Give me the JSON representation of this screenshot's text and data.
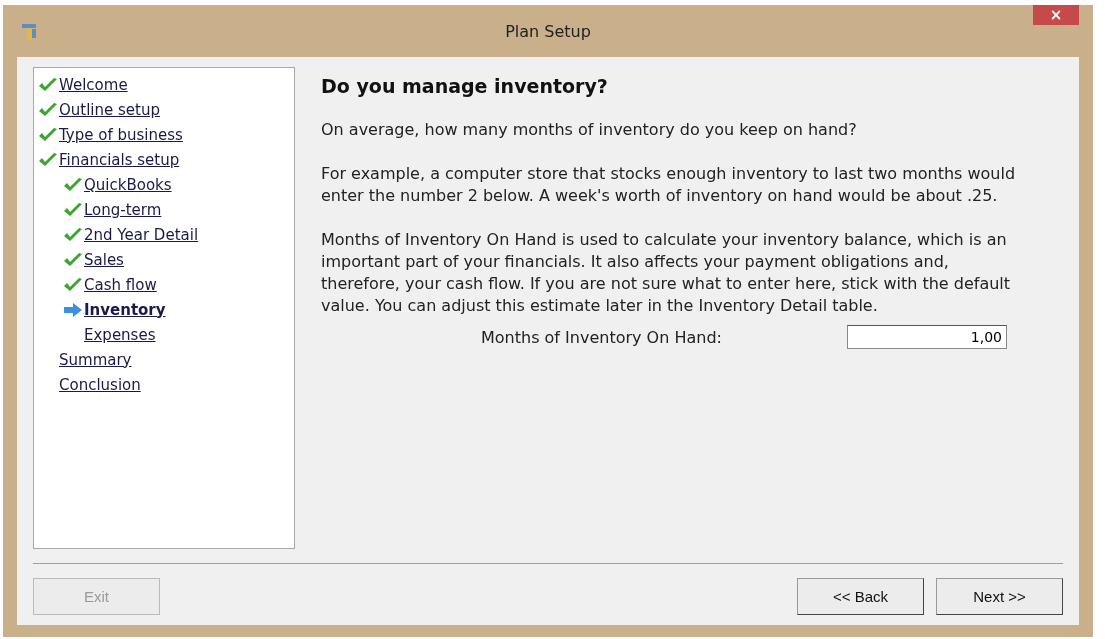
{
  "window": {
    "title": "Plan Setup",
    "close": "×"
  },
  "sidebar": {
    "items": [
      {
        "label": "Welcome",
        "kind": "done",
        "selected": false
      },
      {
        "label": "Outline setup",
        "kind": "done",
        "selected": false
      },
      {
        "label": "Type of business",
        "kind": "done",
        "selected": false
      },
      {
        "label": "Financials setup",
        "kind": "done",
        "selected": false,
        "children": [
          {
            "label": "QuickBooks",
            "kind": "done",
            "selected": false
          },
          {
            "label": "Long-term",
            "kind": "done",
            "selected": false
          },
          {
            "label": "2nd Year Detail",
            "kind": "done",
            "selected": false
          },
          {
            "label": "Sales",
            "kind": "done",
            "selected": false
          },
          {
            "label": "Cash flow",
            "kind": "done",
            "selected": false
          },
          {
            "label": "Inventory",
            "kind": "current",
            "selected": true
          },
          {
            "label": "Expenses",
            "kind": "pending",
            "selected": false
          }
        ]
      },
      {
        "label": "Summary",
        "kind": "pending",
        "selected": false
      },
      {
        "label": "Conclusion",
        "kind": "pending",
        "selected": false
      }
    ]
  },
  "page": {
    "heading": "Do you manage inventory?",
    "paragraphs": [
      "On average, how many months of inventory do you keep on hand?",
      "For example, a computer store that stocks enough inventory to last two months would enter the number 2 below. A week's worth of inventory on hand would be about .25.",
      "Months of Inventory On Hand is used to calculate your inventory balance, which is an important part of your financials. It also affects your payment obligations and, therefore, your cash flow. If you are not sure what to enter here, stick with the default value. You can adjust this estimate later in the Inventory Detail table."
    ],
    "field": {
      "label": "Months of Inventory On Hand:",
      "value": "1,00"
    }
  },
  "buttons": [
    {
      "label": "Exit",
      "disabled": true
    },
    {
      "label": "<< Back",
      "disabled": false
    },
    {
      "label": "Next >>",
      "disabled": false
    }
  ]
}
